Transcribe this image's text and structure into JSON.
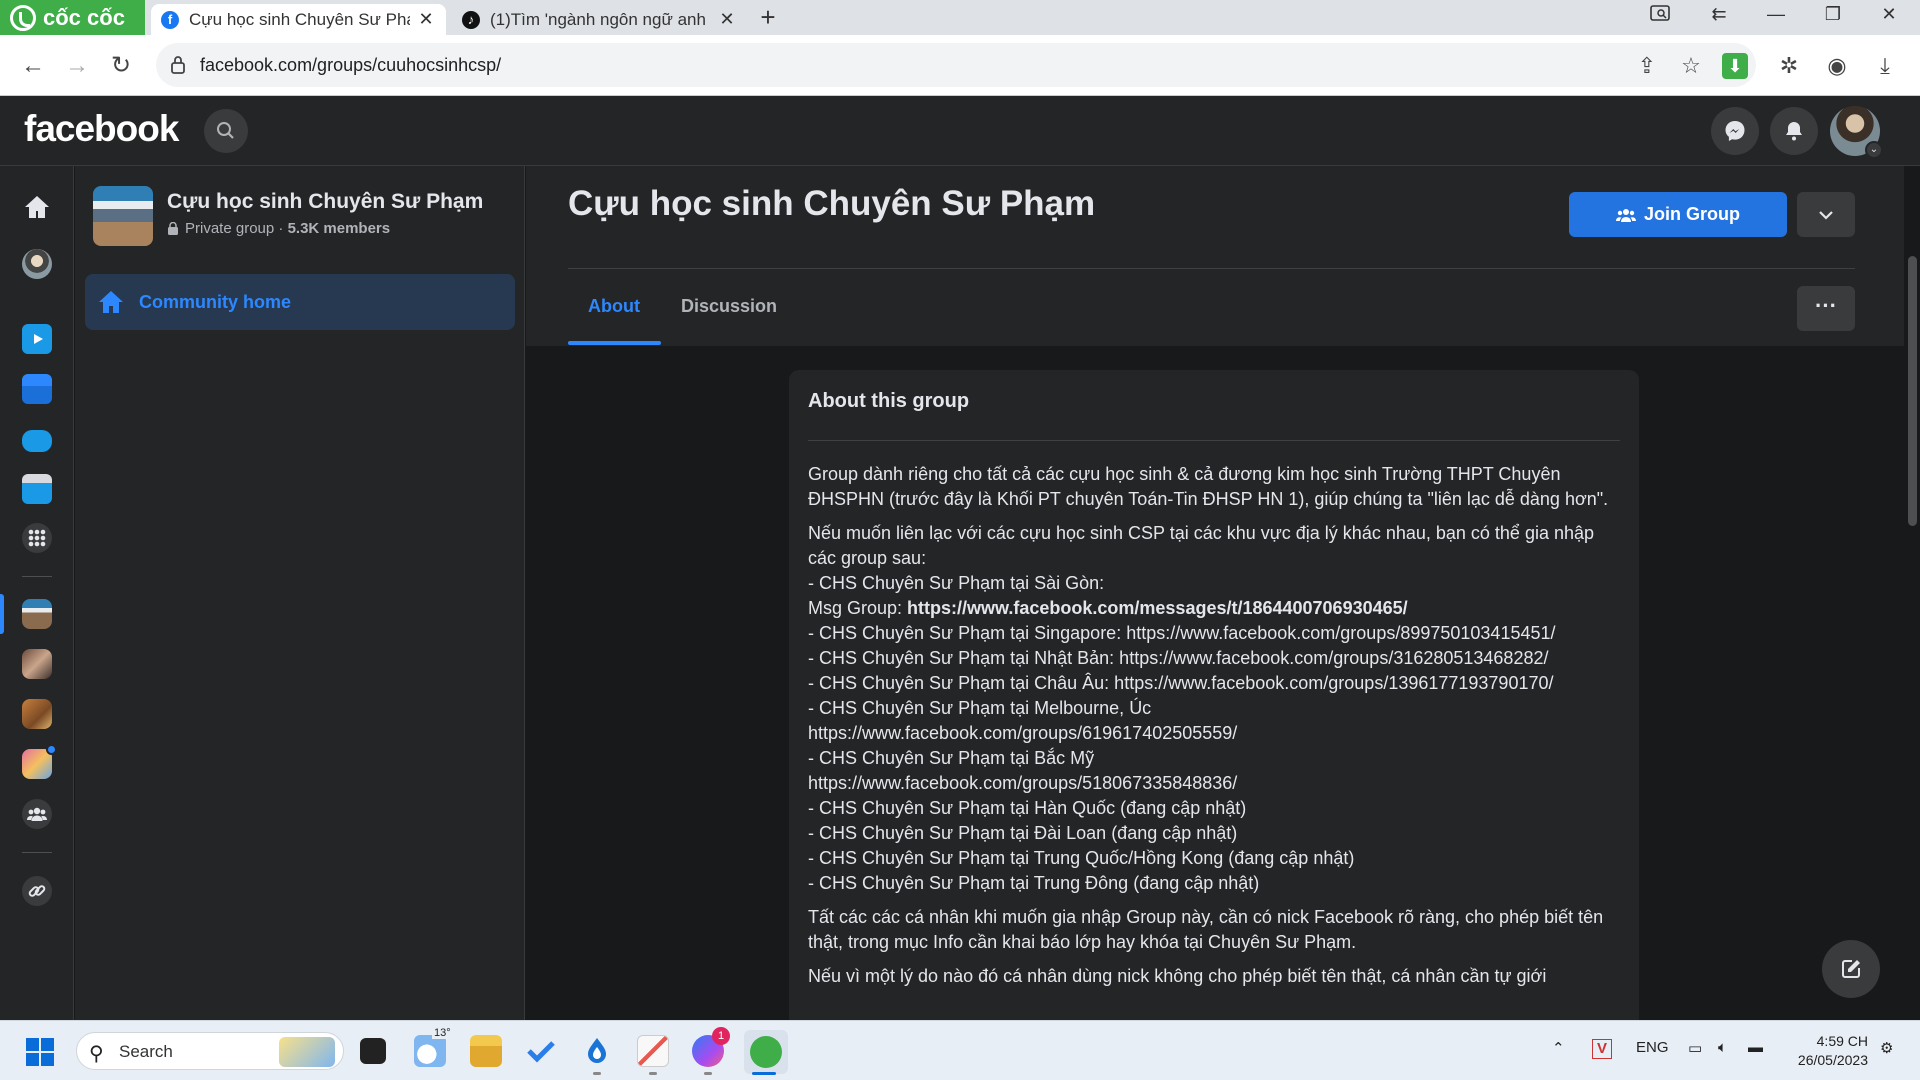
{
  "browser": {
    "brand": "cốc cốc",
    "tabs": [
      {
        "title": "Cựu học sinh Chuyên Sư Phạm",
        "active": true,
        "icon": "facebook-icon"
      },
      {
        "title": "(1)Tìm 'ngành ngôn ngữ anh",
        "active": false,
        "icon": "tiktok-icon"
      }
    ],
    "url": "facebook.com/groups/cuuhocsinhcsp/"
  },
  "fb": {
    "logo": "facebook"
  },
  "group": {
    "name": "Cựu học sinh Chuyên Sư Phạm",
    "privacy": "Private group",
    "separator": " · ",
    "members": "5.3K members",
    "community_home": "Community home",
    "title": "Cựu học sinh Chuyên Sư Phạm",
    "join_label": "Join Group",
    "tabs": {
      "about": "About",
      "discussion": "Discussion"
    },
    "more": "···"
  },
  "about": {
    "title": "About this group",
    "p1": "Group dành riêng cho tất cả các cựu học sinh & cả đương kim học sinh Trường THPT Chuyên ĐHSPHN (trước đây là Khối PT chuyên Toán-Tin ĐHSP HN 1), giúp chúng ta \"liên lạc dễ dàng hơn\".",
    "p2_intro": "Nếu muốn liên lạc với các cựu học sinh CSP tại các khu vực địa lý khác nhau, bạn có thể gia nhập các group sau:",
    "saigon": "- CHS Chuyên Sư Phạm tại Sài Gòn:",
    "msg_label": "Msg Group: ",
    "msg_link": "https://www.facebook.com/messages/t/1864400706930465/",
    "lines": [
      "- CHS Chuyên Sư Phạm tại Singapore: https://www.facebook.com/groups/899750103415451/",
      "- CHS Chuyên Sư Phạm tại Nhật Bản: https://www.facebook.com/groups/316280513468282/",
      "- CHS Chuyên Sư Phạm tại Châu Âu: https://www.facebook.com/groups/1396177193790170/",
      "- CHS Chuyên Sư Phạm tại Melbourne, Úc",
      "https://www.facebook.com/groups/619617402505559/",
      "- CHS Chuyên Sư Phạm tại Bắc Mỹ",
      "https://www.facebook.com/groups/518067335848836/",
      "- CHS Chuyên Sư Phạm tại Hàn Quốc (đang cập nhật)",
      "- CHS Chuyên Sư Phạm tại Đài Loan (đang cập nhật)",
      "- CHS Chuyên Sư Phạm tại Trung Quốc/Hồng Kong (đang cập nhật)",
      "- CHS Chuyên Sư Phạm tại Trung Đông (đang cập nhật)"
    ],
    "p3": "Tất các các cá nhân khi muốn gia nhập Group này, cần có nick Facebook rõ ràng, cho phép biết tên thật, trong mục Info cần khai báo lớp hay khóa tại Chuyên Sư Phạm.",
    "p4": "Nếu vì một lý do nào đó cá nhân dùng nick không cho phép biết tên thật, cá nhân cần tự giới"
  },
  "taskbar": {
    "search_label": "Search",
    "weather_temp": "13°",
    "messenger_badge": "1",
    "lang": "ENG",
    "time": "4:59 CH",
    "date": "26/05/2023"
  },
  "colors": {
    "fb_blue": "#2374e1",
    "fb_link": "#2d88ff",
    "coccoc_green": "#3fae49"
  }
}
